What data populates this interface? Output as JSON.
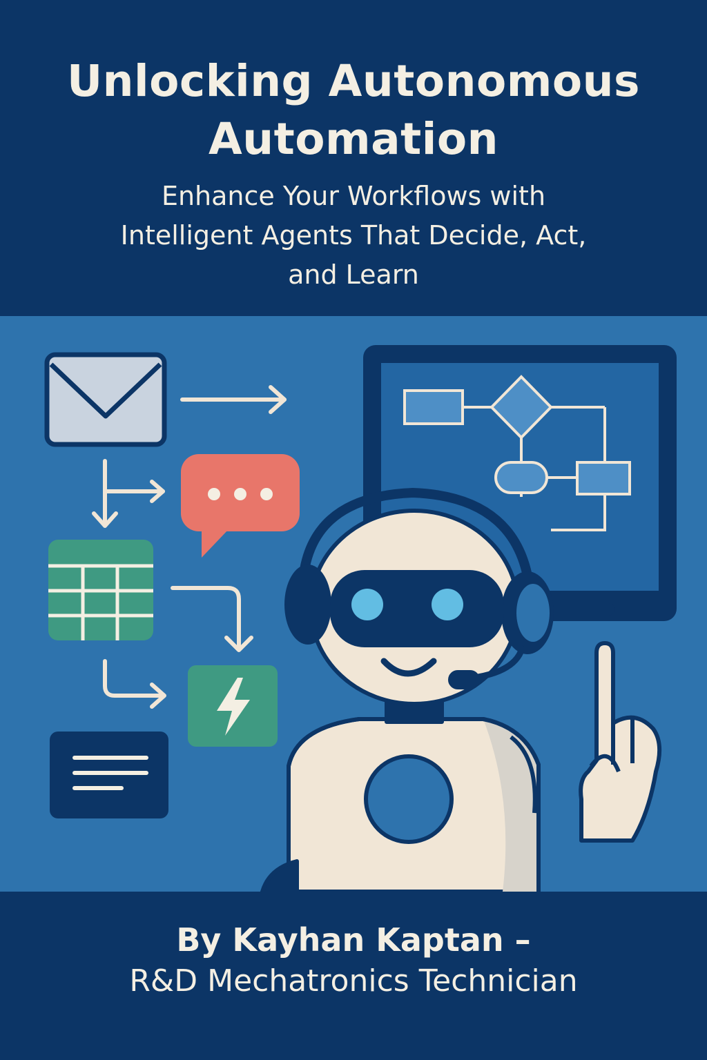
{
  "cover": {
    "title": "Unlocking Autonomous Automation",
    "subtitle_lines": [
      "Enhance Your Workflows with",
      "Intelligent Agents That Decide, Act,",
      "and Learn"
    ],
    "author_line": "By Kayhan Kaptan –",
    "role_line": "R&D Mechatronics Technician"
  },
  "illustration": {
    "icons": [
      "envelope-icon",
      "chat-bubble-icon",
      "spreadsheet-icon",
      "lightning-bolt-icon",
      "document-card-icon",
      "flowchart-monitor",
      "robot-with-headset"
    ]
  },
  "colors": {
    "header_bg": "#0c3566",
    "art_bg": "#2e73ad",
    "text": "#f4efe3",
    "chat": "#e8766a",
    "green": "#3f9a82",
    "robot_body": "#f1e6d6"
  }
}
